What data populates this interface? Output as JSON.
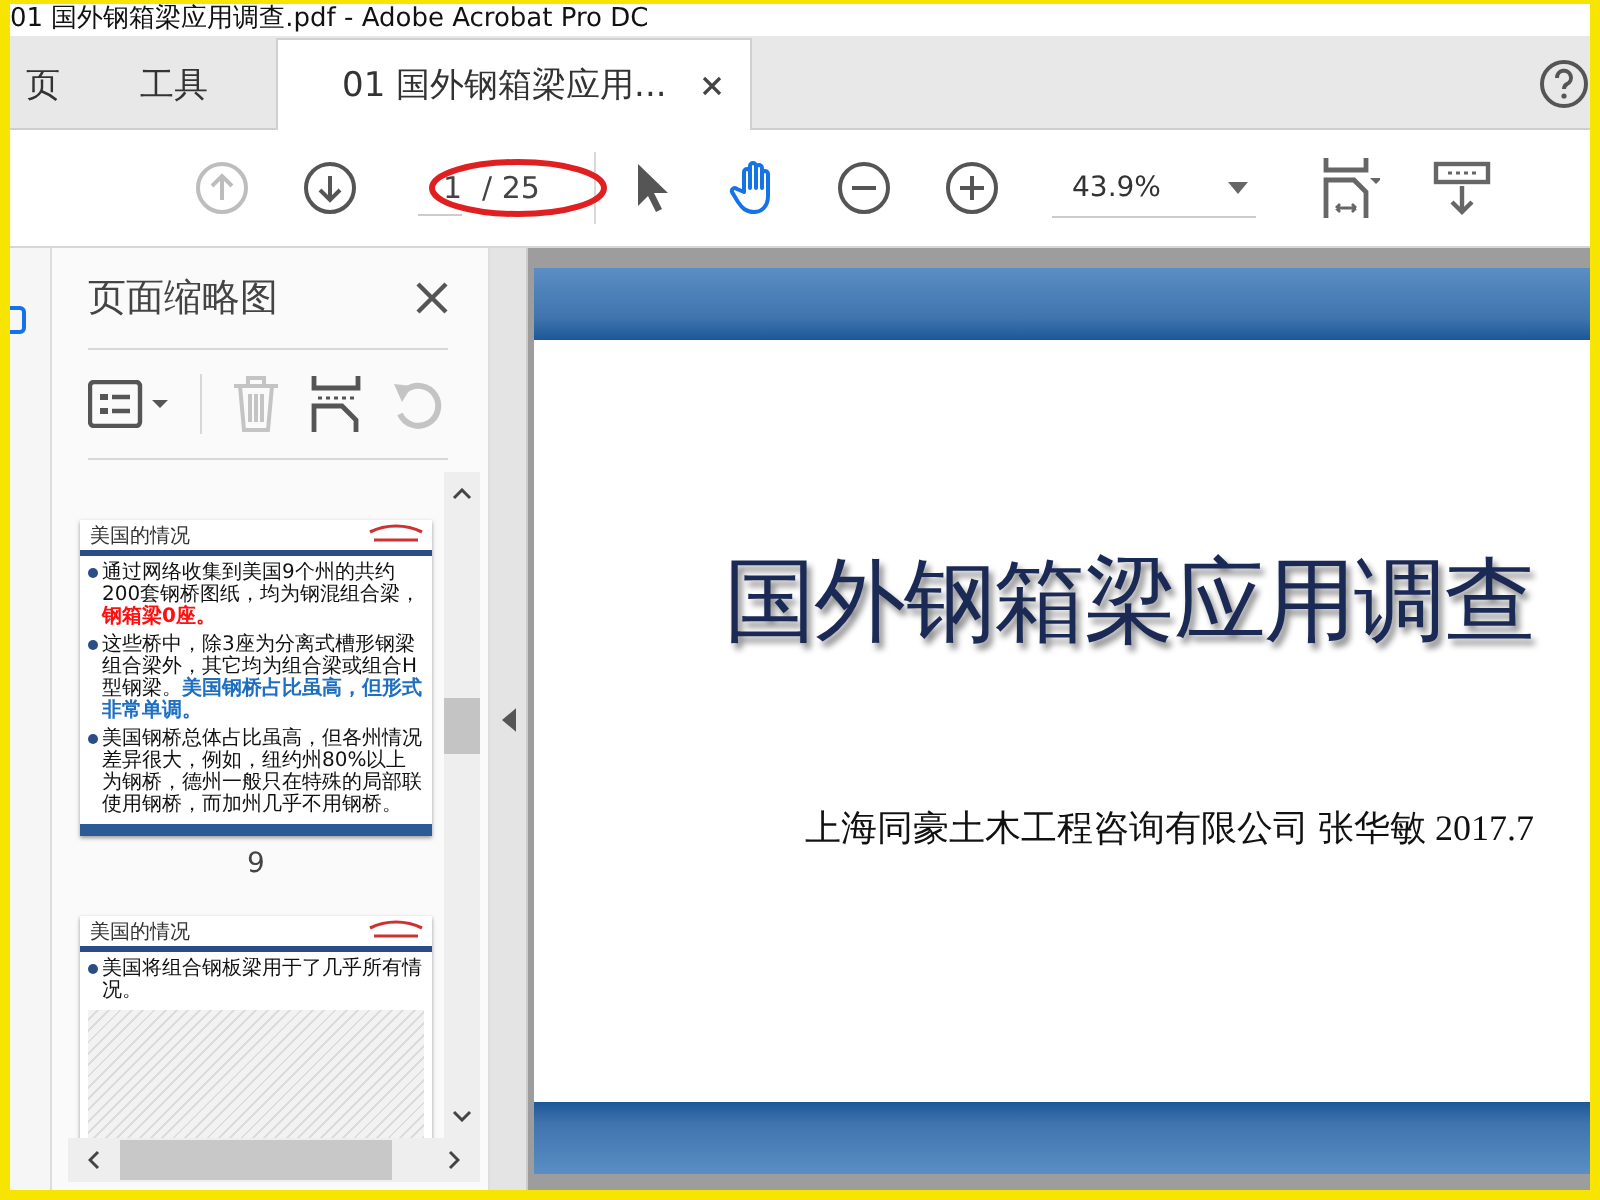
{
  "window": {
    "title": "01 国外钢箱梁应用调查.pdf - Adobe Acrobat Pro DC"
  },
  "tabs": [
    {
      "label": "页",
      "selected": false,
      "closable": false
    },
    {
      "label": "工具",
      "selected": false,
      "closable": false
    },
    {
      "label": "01 国外钢箱梁应用...",
      "selected": true,
      "closable": true
    }
  ],
  "toolbar": {
    "prev_page": {
      "disabled": true
    },
    "next_page": {
      "disabled": false
    },
    "page_number": "1",
    "page_count": "/ 25",
    "tools": [
      {
        "kind": "select",
        "selected": false
      },
      {
        "kind": "hand",
        "selected": true
      }
    ],
    "zoom": "43.9%"
  },
  "annotations": [
    {
      "kind": "ellipse"
    }
  ],
  "sidebar": {
    "title": "页面缩略图",
    "tools": [
      {
        "kind": "options",
        "disabled": false
      },
      {
        "kind": "delete",
        "disabled": true
      },
      {
        "kind": "extract",
        "disabled": false
      },
      {
        "kind": "rotate",
        "disabled": true
      }
    ],
    "thumbnails": [
      {
        "kind": "text",
        "heading": "美国的情况",
        "page_label": "9",
        "bullets": [
          [
            {
              "kind": "plain",
              "text": "通过网络收集到美国9个州的共约200套钢桥图纸，均为钢混组合梁，"
            },
            {
              "kind": "alert",
              "text": "钢箱梁0座。"
            }
          ],
          [
            {
              "kind": "plain",
              "text": "这些桥中，除3座为分离式槽形钢梁组合梁外，其它均为组合梁或组合H型钢梁。"
            },
            {
              "kind": "highlight",
              "text": "美国钢桥占比虽高，但形式非常单调。"
            }
          ],
          [
            {
              "kind": "plain",
              "text": "美国钢桥总体占比虽高，但各州情况差异很大，例如，纽约州80%以上为钢桥，德州一般只在特殊的局部联使用钢桥，而加州几乎不用钢桥。"
            }
          ]
        ]
      },
      {
        "kind": "drawings",
        "heading": "美国的情况",
        "bullets": [
          [
            {
              "kind": "plain",
              "text": "美国将组合钢板梁用于了几乎所有情况。"
            }
          ]
        ]
      }
    ]
  },
  "document": {
    "title": "国外钢箱梁应用调查",
    "subtitle": "上海同豪土木工程咨询有限公司 张华敏 2017.7"
  }
}
